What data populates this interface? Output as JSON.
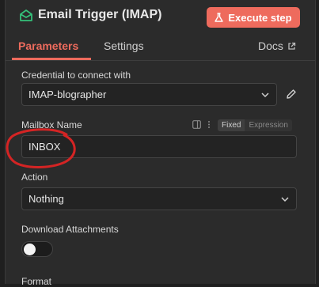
{
  "header": {
    "title": "Email Trigger (IMAP)",
    "node_icon": "envelope-open-icon",
    "execute_label": "Execute step",
    "execute_icon": "flask-icon"
  },
  "tabs": [
    {
      "label": "Parameters",
      "active": true
    },
    {
      "label": "Settings",
      "active": false
    },
    {
      "label": "Docs",
      "active": false,
      "icon": "external-link-icon"
    }
  ],
  "fields": {
    "credential": {
      "label": "Credential to connect with",
      "value": "IMAP-blographer",
      "icon": "pencil-icon"
    },
    "mailbox": {
      "label": "Mailbox Name",
      "value": "INBOX",
      "mode_options": [
        "Fixed",
        "Expression"
      ],
      "mode_selected": "Fixed"
    },
    "action": {
      "label": "Action",
      "value": "Nothing"
    },
    "download_attachments": {
      "label": "Download Attachments",
      "enabled": false
    },
    "format": {
      "label": "Format"
    }
  },
  "colors": {
    "accent": "#ee6b5d",
    "annotation": "#d42424"
  }
}
